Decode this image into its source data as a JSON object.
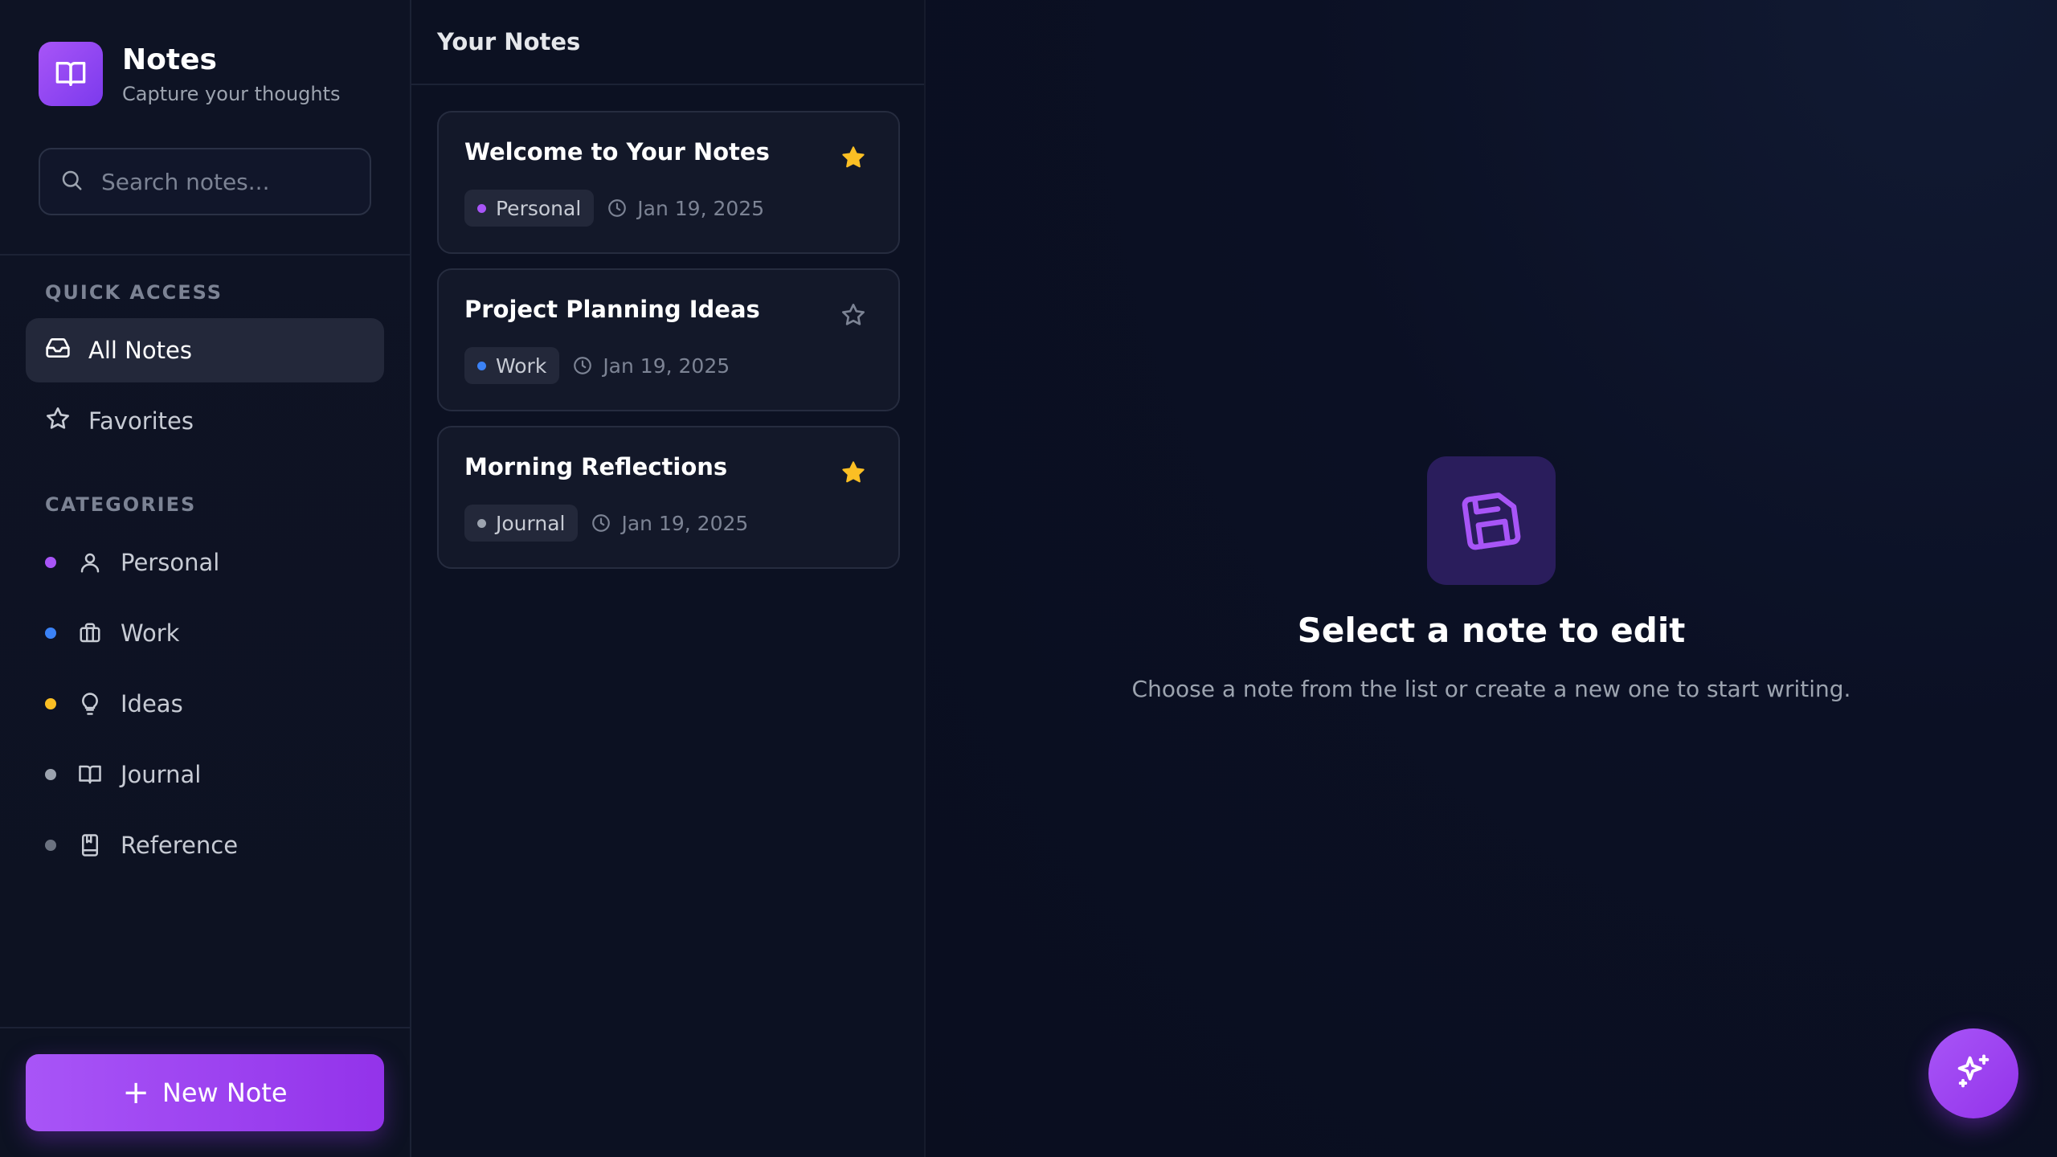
{
  "theme": {
    "accent": "#a855f7",
    "star_color": "#fbbf24",
    "background": "#0b0f1f"
  },
  "brand": {
    "title": "Notes",
    "subtitle": "Capture your thoughts",
    "icon": "book-open-icon"
  },
  "search": {
    "placeholder": "Search notes...",
    "value": "",
    "icon": "search-icon"
  },
  "quick_access": {
    "label": "QUICK ACCESS",
    "items": [
      {
        "label": "All Notes",
        "icon": "inbox-icon",
        "active": true
      },
      {
        "label": "Favorites",
        "icon": "star-icon",
        "active": false
      }
    ]
  },
  "categories": {
    "label": "CATEGORIES",
    "items": [
      {
        "label": "Personal",
        "icon": "user-icon",
        "color": "#a855f7"
      },
      {
        "label": "Work",
        "icon": "briefcase-icon",
        "color": "#3b82f6"
      },
      {
        "label": "Ideas",
        "icon": "lightbulb-icon",
        "color": "#fbbf24"
      },
      {
        "label": "Journal",
        "icon": "book-open-icon",
        "color": "#9ca3af"
      },
      {
        "label": "Reference",
        "icon": "bookmark-book-icon",
        "color": "#6b7280"
      }
    ]
  },
  "new_note": {
    "label": "New Note",
    "icon": "plus-icon"
  },
  "note_list": {
    "header": "Your Notes",
    "notes": [
      {
        "title": "Welcome to Your Notes",
        "category": "Personal",
        "category_color": "#a855f7",
        "date": "Jan 19, 2025",
        "favorite": true
      },
      {
        "title": "Project Planning Ideas",
        "category": "Work",
        "category_color": "#3b82f6",
        "date": "Jan 19, 2025",
        "favorite": false
      },
      {
        "title": "Morning Reflections",
        "category": "Journal",
        "category_color": "#9ca3af",
        "date": "Jan 19, 2025",
        "favorite": true
      }
    ]
  },
  "empty_state": {
    "icon": "save-icon",
    "title": "Select a note to edit",
    "subtitle": "Choose a note from the list or create a new one to start writing."
  },
  "fab": {
    "icon": "sparkles-icon"
  }
}
